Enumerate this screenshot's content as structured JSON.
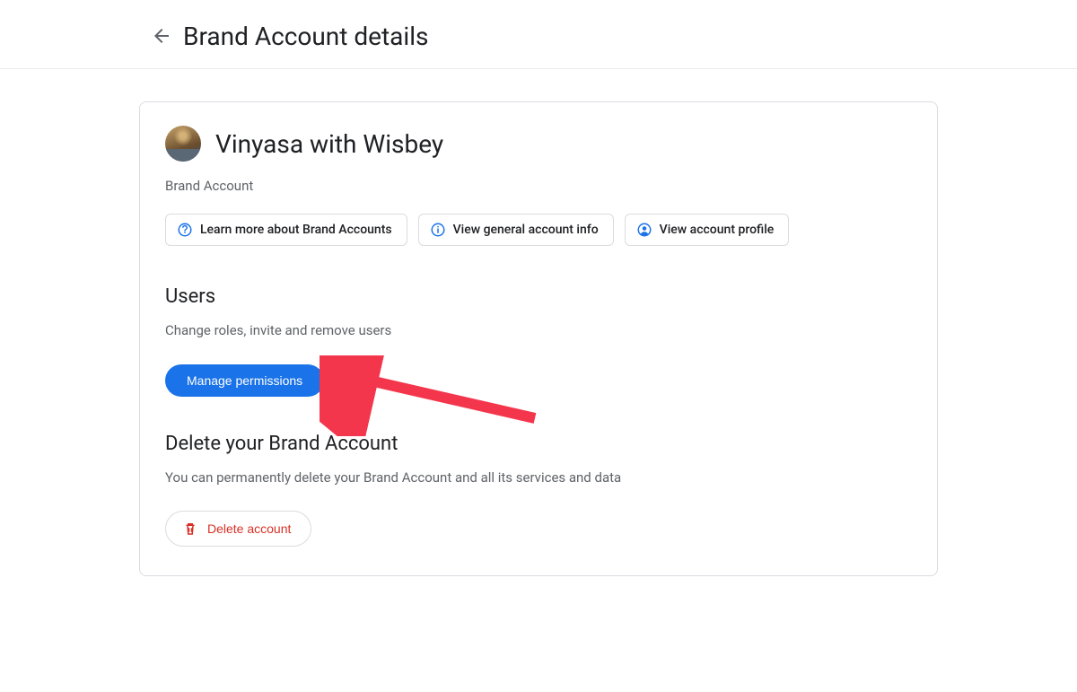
{
  "header": {
    "title": "Brand Account details"
  },
  "account": {
    "name": "Vinyasa with Wisbey",
    "type_label": "Brand Account"
  },
  "chips": {
    "learn_more": "Learn more about Brand Accounts",
    "view_info": "View general account info",
    "view_profile": "View account profile"
  },
  "users": {
    "title": "Users",
    "desc": "Change roles, invite and remove users",
    "manage_btn": "Manage permissions"
  },
  "delete": {
    "title": "Delete your Brand Account",
    "desc": "You can permanently delete your Brand Account and all its services and data",
    "btn": "Delete account"
  }
}
